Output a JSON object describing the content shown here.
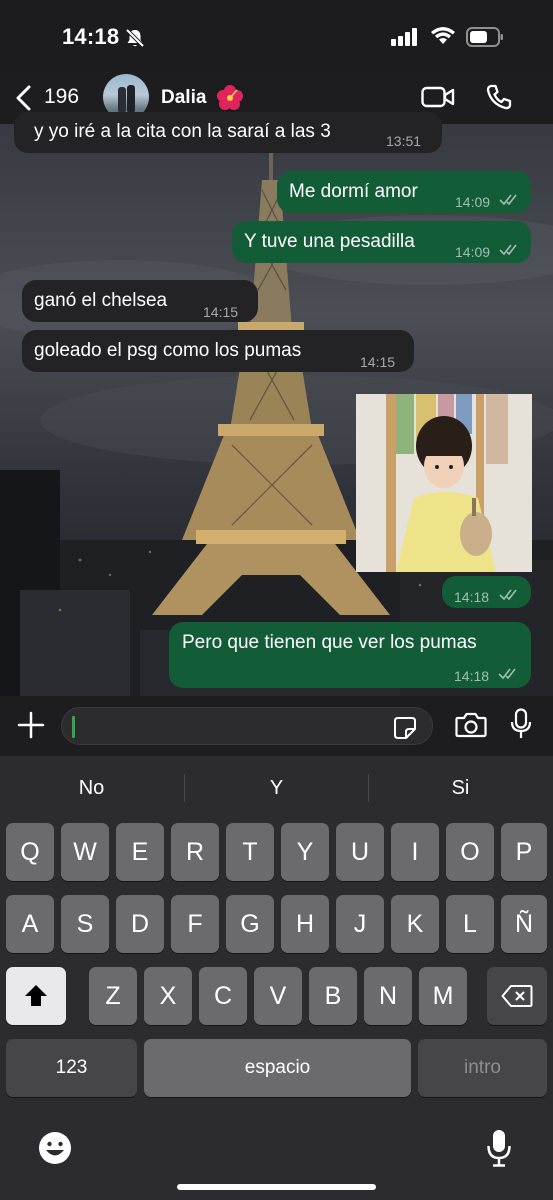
{
  "status_bar": {
    "time": "14:18"
  },
  "header": {
    "back_count": "196",
    "contact_name": "Dalia",
    "contact_emoji": "🌺"
  },
  "messages": [
    {
      "dir": "in",
      "text": "y yo iré a la cita con la saraí a las 3",
      "time": "13:51"
    },
    {
      "dir": "out",
      "text": "Me dormí amor",
      "time": "14:09"
    },
    {
      "dir": "out",
      "text": "Y tuve una pesadilla",
      "time": "14:09"
    },
    {
      "dir": "in",
      "text": "ganó el chelsea",
      "time": "14:15"
    },
    {
      "dir": "in",
      "text": "goleado el psg como los pumas",
      "time": "14:15"
    },
    {
      "dir": "out",
      "type": "image",
      "image_desc": "toddler-photo",
      "time": "14:18"
    },
    {
      "dir": "out",
      "text": "Pero que tienen que ver los pumas",
      "time": "14:18"
    }
  ],
  "input": {
    "placeholder": ""
  },
  "keyboard": {
    "suggestions": [
      "No",
      "Y",
      "Si"
    ],
    "row1": [
      "Q",
      "W",
      "E",
      "R",
      "T",
      "Y",
      "U",
      "I",
      "O",
      "P"
    ],
    "row2": [
      "A",
      "S",
      "D",
      "F",
      "G",
      "H",
      "J",
      "K",
      "L",
      "Ñ"
    ],
    "row3": [
      "Z",
      "X",
      "C",
      "V",
      "B",
      "N",
      "M"
    ],
    "numbers_label": "123",
    "space_label": "espacio",
    "return_label": "intro"
  },
  "colors": {
    "outgoing_bubble": "#135c38",
    "incoming_bubble": "#232325",
    "accent_green": "#2ea74d"
  }
}
